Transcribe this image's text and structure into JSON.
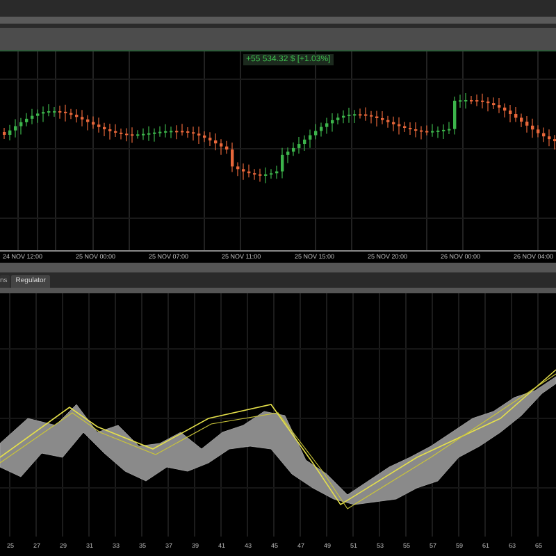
{
  "price_chart": {
    "price_label": "+55 534.32 $ [+1.03%]",
    "time_labels": [
      "24 NOV 12:00",
      "25 NOV 00:00",
      "25 NOV 07:00",
      "25 NOV 11:00",
      "25 NOV 15:00",
      "25 NOV 20:00",
      "26 NOV 00:00",
      "26 NOV 04:00"
    ]
  },
  "tabs": [
    {
      "label": "ns",
      "selected": false
    },
    {
      "label": "Regulator",
      "selected": true
    }
  ],
  "lower_chart": {
    "axis_labels": [
      "25",
      "27",
      "29",
      "31",
      "33",
      "35",
      "37",
      "39",
      "41",
      "43",
      "45",
      "47",
      "49",
      "51",
      "53",
      "55",
      "57",
      "59",
      "61",
      "63",
      "65"
    ]
  }
}
